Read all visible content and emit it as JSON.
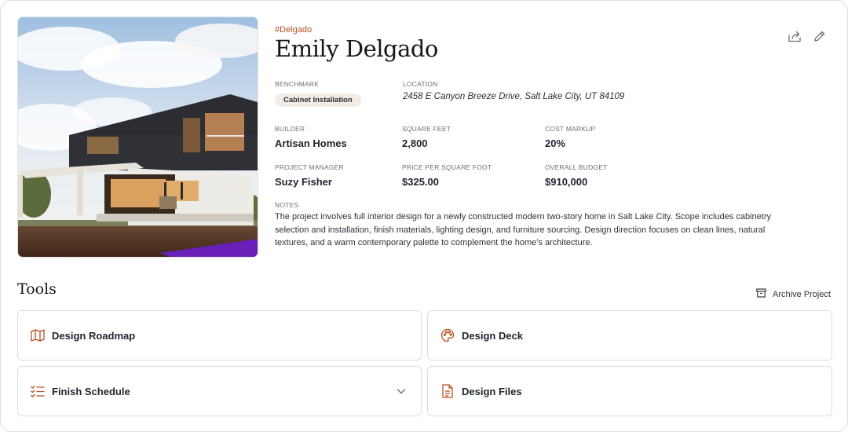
{
  "project": {
    "tag": "#Delgado",
    "title": "Emily Delgado"
  },
  "header_actions": [
    {
      "icon": "share-icon"
    },
    {
      "icon": "edit-pencil-icon"
    }
  ],
  "fields": {
    "benchmark": {
      "label": "BENCHMARK",
      "value": "Cabinet Installation"
    },
    "location": {
      "label": "LOCATION",
      "value": "2458 E Canyon Breeze Drive, Salt Lake City, UT 84109"
    },
    "builder": {
      "label": "BUILDER",
      "value": "Artisan Homes"
    },
    "square_feet": {
      "label": "SQUARE FEET",
      "value": "2,800"
    },
    "cost_markup": {
      "label": "COST MARKUP",
      "value": "20%"
    },
    "project_manager": {
      "label": "PROJECT MANAGER",
      "value": "Suzy Fisher"
    },
    "price_per_sqft": {
      "label": "PRICE PER SQUARE FOOT",
      "value": "$325.00"
    },
    "overall_budget": {
      "label": "OVERALL BUDGET",
      "value": "$910,000"
    },
    "notes": {
      "label": "NOTES",
      "value": "The project involves full interior design for a newly constructed modern two-story home in Salt Lake City. Scope includes cabinetry selection and installation, finish materials, lighting design, and furniture sourcing. Design direction focuses on clean lines, natural textures, and a warm contemporary palette to complement the home’s architecture."
    }
  },
  "tools": {
    "title": "Tools",
    "archive_label": "Archive Project",
    "cards": [
      {
        "label": "Design Roadmap",
        "icon": "map-icon"
      },
      {
        "label": "Design Deck",
        "icon": "palette-icon"
      },
      {
        "label": "Finish Schedule",
        "icon": "checklist-icon"
      },
      {
        "label": "Design Files",
        "icon": "document-icon"
      }
    ]
  },
  "colors": {
    "accent": "#b5501e",
    "badge_bg": "#f1ece6",
    "border": "#dcdde0"
  }
}
